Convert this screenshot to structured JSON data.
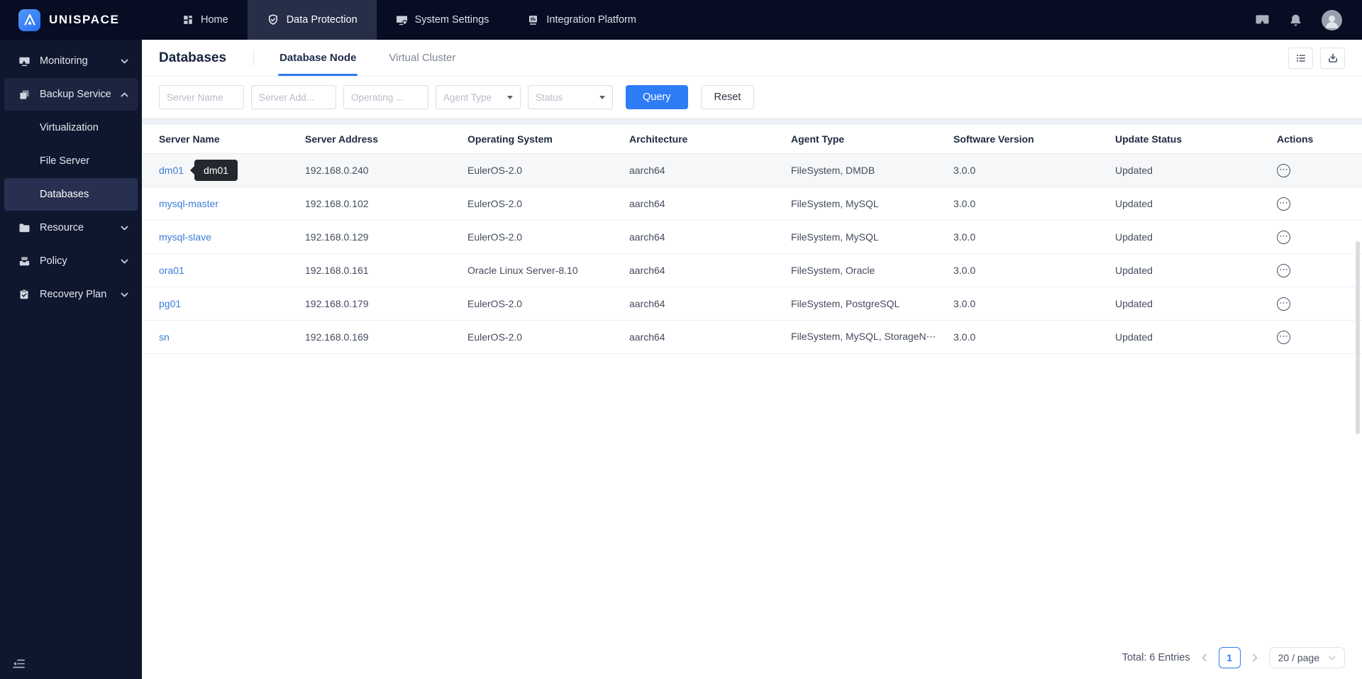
{
  "brand": {
    "name": "UNISPACE"
  },
  "topnav": {
    "items": [
      {
        "label": "Home"
      },
      {
        "label": "Data Protection",
        "active": true
      },
      {
        "label": "System Settings"
      },
      {
        "label": "Integration Platform"
      }
    ]
  },
  "sidebar": {
    "items": [
      {
        "label": "Monitoring"
      },
      {
        "label": "Backup Service",
        "active": true
      },
      {
        "label": "Virtualization"
      },
      {
        "label": "File Server"
      },
      {
        "label": "Databases",
        "selected": true
      },
      {
        "label": "Resource"
      },
      {
        "label": "Policy"
      },
      {
        "label": "Recovery Plan"
      }
    ]
  },
  "page": {
    "title": "Databases",
    "tabs": [
      {
        "label": "Database Node",
        "active": true
      },
      {
        "label": "Virtual Cluster"
      }
    ]
  },
  "filters": {
    "server_name_placeholder": "Server Name",
    "server_address_placeholder": "Server Add...",
    "os_placeholder": "Operating ...",
    "agent_type_placeholder": "Agent Type",
    "status_placeholder": "Status",
    "query_label": "Query",
    "reset_label": "Reset"
  },
  "table": {
    "columns": [
      "Server Name",
      "Server Address",
      "Operating System",
      "Architecture",
      "Agent Type",
      "Software Version",
      "Update Status",
      "Actions"
    ],
    "tooltip": "dm01",
    "rows": [
      {
        "server_name": "dm01",
        "server_address": "192.168.0.240",
        "os": "EulerOS-2.0",
        "architecture": "aarch64",
        "agent_type": "FileSystem, DMDB",
        "software_version": "3.0.0",
        "update_status": "Updated"
      },
      {
        "server_name": "mysql-master",
        "server_address": "192.168.0.102",
        "os": "EulerOS-2.0",
        "architecture": "aarch64",
        "agent_type": "FileSystem, MySQL",
        "software_version": "3.0.0",
        "update_status": "Updated"
      },
      {
        "server_name": "mysql-slave",
        "server_address": "192.168.0.129",
        "os": "EulerOS-2.0",
        "architecture": "aarch64",
        "agent_type": "FileSystem, MySQL",
        "software_version": "3.0.0",
        "update_status": "Updated"
      },
      {
        "server_name": "ora01",
        "server_address": "192.168.0.161",
        "os": "Oracle Linux Server-8.10",
        "architecture": "aarch64",
        "agent_type": "FileSystem, Oracle",
        "software_version": "3.0.0",
        "update_status": "Updated"
      },
      {
        "server_name": "pg01",
        "server_address": "192.168.0.179",
        "os": "EulerOS-2.0",
        "architecture": "aarch64",
        "agent_type": "FileSystem, PostgreSQL",
        "software_version": "3.0.0",
        "update_status": "Updated"
      },
      {
        "server_name": "sn",
        "server_address": "192.168.0.169",
        "os": "EulerOS-2.0",
        "architecture": "aarch64",
        "agent_type": "FileSystem, MySQL, StorageN⋯",
        "software_version": "3.0.0",
        "update_status": "Updated"
      }
    ]
  },
  "pagination": {
    "total_label": "Total: 6 Entries",
    "current_page": "1",
    "page_size_label": "20 / page"
  },
  "icons": {
    "more_actions": "⋯",
    "accent_color": "#2e7cf6",
    "names": [
      "mountain-logo-icon",
      "home-icon",
      "shield-icon",
      "display-icon",
      "platform-icon",
      "chat-icon",
      "bell-icon",
      "user-avatar",
      "monitor-cast-icon",
      "copy-icon",
      "folder-icon",
      "inbox-icon",
      "clipboard-check-icon",
      "chevron-down-icon",
      "chevron-up-icon",
      "collapse-sidebar-icon",
      "column-settings-icon",
      "download-icon",
      "more-actions-icon"
    ]
  }
}
